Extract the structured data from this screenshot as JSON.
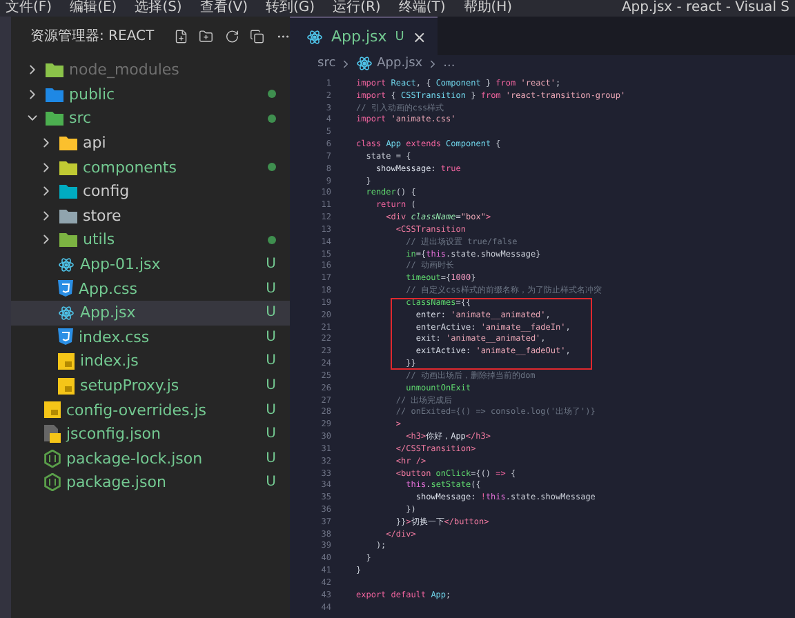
{
  "menu_bar": {
    "items": [
      "文件(F)",
      "编辑(E)",
      "选择(S)",
      "查看(V)",
      "转到(G)",
      "运行(R)",
      "终端(T)",
      "帮助(H)"
    ],
    "window_title": "App.jsx - react - Visual S"
  },
  "explorer": {
    "title": "资源管理器: REACT",
    "items": [
      {
        "name": "node_modules",
        "kind": "folder",
        "color": "#8bc34a",
        "expanded": false,
        "ignored": true,
        "modified": false,
        "selected": false
      },
      {
        "name": "public",
        "kind": "folder",
        "color": "#1e88e5",
        "expanded": false,
        "ignored": false,
        "modified": true,
        "selected": false
      },
      {
        "name": "src",
        "kind": "folder",
        "color": "#4caf50",
        "expanded": true,
        "ignored": false,
        "modified": true,
        "selected": false,
        "children": [
          {
            "name": "api",
            "kind": "folder",
            "color": "#fbc02d",
            "expanded": false,
            "ignored": false,
            "modified": false,
            "selected": false
          },
          {
            "name": "components",
            "kind": "folder",
            "color": "#c0ca33",
            "expanded": false,
            "ignored": false,
            "modified": true,
            "selected": false
          },
          {
            "name": "config",
            "kind": "folder",
            "color": "#00acc1",
            "expanded": false,
            "ignored": false,
            "modified": false,
            "selected": false
          },
          {
            "name": "store",
            "kind": "folder",
            "color": "#90a4ae",
            "expanded": false,
            "ignored": false,
            "modified": false,
            "selected": false
          },
          {
            "name": "utils",
            "kind": "folder",
            "color": "#7cb342",
            "expanded": false,
            "ignored": false,
            "modified": true,
            "selected": false
          },
          {
            "name": "App-01.jsx",
            "kind": "react",
            "badge": "U",
            "ignored": false,
            "modified": false,
            "selected": false
          },
          {
            "name": "App.css",
            "kind": "css",
            "badge": "U",
            "ignored": false,
            "modified": false,
            "selected": false
          },
          {
            "name": "App.jsx",
            "kind": "react",
            "badge": "U",
            "ignored": false,
            "modified": false,
            "selected": true
          },
          {
            "name": "index.css",
            "kind": "css",
            "badge": "U",
            "ignored": false,
            "modified": false,
            "selected": false
          },
          {
            "name": "index.js",
            "kind": "js",
            "badge": "U",
            "ignored": false,
            "modified": false,
            "selected": false
          },
          {
            "name": "setupProxy.js",
            "kind": "js",
            "badge": "U",
            "ignored": false,
            "modified": false,
            "selected": false
          }
        ]
      },
      {
        "name": "config-overrides.js",
        "kind": "js",
        "badge": "U",
        "ignored": false,
        "modified": false,
        "selected": false
      },
      {
        "name": "jsconfig.json",
        "kind": "jsconfig",
        "badge": "U",
        "ignored": false,
        "modified": false,
        "selected": false
      },
      {
        "name": "package-lock.json",
        "kind": "node",
        "badge": "U",
        "ignored": false,
        "modified": false,
        "selected": false
      },
      {
        "name": "package.json",
        "kind": "node",
        "badge": "U",
        "ignored": false,
        "modified": false,
        "selected": false
      }
    ]
  },
  "tabs": [
    {
      "label": "App.jsx",
      "kind": "react",
      "badge": "U",
      "close": "×",
      "selected": true
    }
  ],
  "breadcrumb": [
    "src",
    "App.jsx",
    "..."
  ],
  "code": [
    {
      "n": "1",
      "boxed": false,
      "tokens": [
        {
          "kind": "kw",
          "t": "import "
        },
        {
          "kind": "cls",
          "t": "React"
        },
        {
          "kind": "p",
          "t": ", { "
        },
        {
          "kind": "cls",
          "t": "Component"
        },
        {
          "kind": "p",
          "t": " } "
        },
        {
          "kind": "kw",
          "t": "from "
        },
        {
          "kind": "str",
          "t": "'react'"
        },
        {
          "kind": "p",
          "t": ";"
        }
      ]
    },
    {
      "n": "2",
      "boxed": false,
      "tokens": [
        {
          "kind": "kw",
          "t": "import "
        },
        {
          "kind": "p",
          "t": "{ "
        },
        {
          "kind": "cls",
          "t": "CSSTransition"
        },
        {
          "kind": "p",
          "t": " } "
        },
        {
          "kind": "kw",
          "t": "from "
        },
        {
          "kind": "str",
          "t": "'react-transition-group'"
        }
      ]
    },
    {
      "n": "3",
      "boxed": false,
      "tokens": [
        {
          "kind": "cm",
          "t": "// 引入动画的css样式"
        }
      ]
    },
    {
      "n": "4",
      "boxed": false,
      "tokens": [
        {
          "kind": "kw",
          "t": "import "
        },
        {
          "kind": "str",
          "t": "'animate.css'"
        }
      ]
    },
    {
      "n": "5",
      "boxed": false
    },
    {
      "n": "6",
      "boxed": false,
      "tokens": [
        {
          "kind": "kw",
          "t": "class "
        },
        {
          "kind": "cls",
          "t": "App "
        },
        {
          "kind": "kw",
          "t": "extends "
        },
        {
          "kind": "cls",
          "t": "Component"
        },
        {
          "kind": "p",
          "t": " {"
        }
      ]
    },
    {
      "n": "7",
      "boxed": false,
      "tokens": [
        {
          "kind": "p",
          "t": "  state = {"
        }
      ]
    },
    {
      "n": "8",
      "boxed": false,
      "tokens": [
        {
          "kind": "prop",
          "t": "    showMessage: "
        },
        {
          "kind": "kw",
          "t": "true"
        }
      ]
    },
    {
      "n": "9",
      "boxed": false,
      "tokens": [
        {
          "kind": "p",
          "t": "  }"
        }
      ]
    },
    {
      "n": "10",
      "boxed": false,
      "tokens": [
        {
          "kind": "fn",
          "t": "  render"
        },
        {
          "kind": "p",
          "t": "() {"
        }
      ]
    },
    {
      "n": "11",
      "boxed": false,
      "tokens": [
        {
          "kind": "kw",
          "t": "    return "
        },
        {
          "kind": "p",
          "t": "("
        }
      ]
    },
    {
      "n": "12",
      "boxed": false,
      "tokens": [
        {
          "kind": "tag",
          "t": "      <div "
        },
        {
          "kind": "attr",
          "t": "className"
        },
        {
          "kind": "p",
          "t": "="
        },
        {
          "kind": "str",
          "t": "\"box\""
        },
        {
          "kind": "tag",
          "t": ">"
        }
      ]
    },
    {
      "n": "13",
      "boxed": false,
      "tokens": [
        {
          "kind": "tag",
          "t": "        <CSSTransition"
        }
      ]
    },
    {
      "n": "14",
      "boxed": false,
      "tokens": [
        {
          "kind": "cm",
          "t": "          // 进出场设置 true/false"
        }
      ]
    },
    {
      "n": "15",
      "boxed": false,
      "tokens": [
        {
          "kind": "jsx",
          "t": "          in"
        },
        {
          "kind": "p",
          "t": "={"
        },
        {
          "kind": "this",
          "t": "this"
        },
        {
          "kind": "p",
          "t": ".state.showMessage}"
        }
      ]
    },
    {
      "n": "16",
      "boxed": false,
      "tokens": [
        {
          "kind": "cm",
          "t": "          // 动画时长"
        }
      ]
    },
    {
      "n": "17",
      "boxed": false,
      "tokens": [
        {
          "kind": "jsx",
          "t": "          timeout"
        },
        {
          "kind": "p",
          "t": "={"
        },
        {
          "kind": "num",
          "t": "1000"
        },
        {
          "kind": "p",
          "t": "}"
        }
      ]
    },
    {
      "n": "18",
      "boxed": false,
      "tokens": [
        {
          "kind": "cm",
          "t": "          // 自定义css样式的前缀名称，为了防止样式名冲突"
        }
      ]
    },
    {
      "n": "19",
      "boxed": true,
      "tokens": [
        {
          "kind": "jsx",
          "t": "          classNames"
        },
        {
          "kind": "p",
          "t": "={{"
        }
      ]
    },
    {
      "n": "20",
      "boxed": true,
      "tokens": [
        {
          "kind": "prop",
          "t": "            enter: "
        },
        {
          "kind": "str",
          "t": "'animate__animated'"
        },
        {
          "kind": "p",
          "t": ","
        }
      ]
    },
    {
      "n": "21",
      "boxed": true,
      "tokens": [
        {
          "kind": "prop",
          "t": "            enterActive: "
        },
        {
          "kind": "str",
          "t": "'animate__fadeIn'"
        },
        {
          "kind": "p",
          "t": ","
        }
      ]
    },
    {
      "n": "22",
      "boxed": true,
      "tokens": [
        {
          "kind": "prop",
          "t": "            exit: "
        },
        {
          "kind": "str",
          "t": "'animate__animated'"
        },
        {
          "kind": "p",
          "t": ","
        }
      ]
    },
    {
      "n": "23",
      "boxed": true,
      "tokens": [
        {
          "kind": "prop",
          "t": "            exitActive: "
        },
        {
          "kind": "str",
          "t": "'animate__fadeOut'"
        },
        {
          "kind": "p",
          "t": ","
        }
      ]
    },
    {
      "n": "24",
      "boxed": true,
      "tokens": [
        {
          "kind": "p",
          "t": "          }}"
        }
      ]
    },
    {
      "n": "25",
      "boxed": false,
      "tokens": [
        {
          "kind": "cm",
          "t": "          // 动画出场后，删除掉当前的dom"
        }
      ]
    },
    {
      "n": "26",
      "boxed": false,
      "tokens": [
        {
          "kind": "jsx",
          "t": "          unmountOnExit"
        }
      ]
    },
    {
      "n": "27",
      "boxed": false,
      "tokens": [
        {
          "kind": "cm",
          "t": "        // 出场完成后"
        }
      ]
    },
    {
      "n": "28",
      "boxed": false,
      "tokens": [
        {
          "kind": "cm",
          "t": "        // onExited={() => console.log('出场了')}"
        }
      ]
    },
    {
      "n": "29",
      "boxed": false,
      "tokens": [
        {
          "kind": "tag",
          "t": "        >"
        }
      ]
    },
    {
      "n": "30",
      "boxed": false,
      "tokens": [
        {
          "kind": "tag",
          "t": "          <h3>"
        },
        {
          "kind": "prop",
          "t": "你好，App"
        },
        {
          "kind": "tag",
          "t": "</h3>"
        }
      ]
    },
    {
      "n": "31",
      "boxed": false,
      "tokens": [
        {
          "kind": "tag",
          "t": "        </CSSTransition>"
        }
      ]
    },
    {
      "n": "32",
      "boxed": false,
      "tokens": [
        {
          "kind": "tag",
          "t": "        <hr />"
        }
      ]
    },
    {
      "n": "33",
      "boxed": false,
      "tokens": [
        {
          "kind": "tag",
          "t": "        <button "
        },
        {
          "kind": "jsx",
          "t": "onClick"
        },
        {
          "kind": "p",
          "t": "={() "
        },
        {
          "kind": "kw",
          "t": "=>"
        },
        {
          "kind": "p",
          "t": " {"
        }
      ]
    },
    {
      "n": "34",
      "boxed": false,
      "tokens": [
        {
          "kind": "this",
          "t": "          this"
        },
        {
          "kind": "p",
          "t": "."
        },
        {
          "kind": "fn",
          "t": "setState"
        },
        {
          "kind": "p",
          "t": "({"
        }
      ]
    },
    {
      "n": "35",
      "boxed": false,
      "tokens": [
        {
          "kind": "prop",
          "t": "            showMessage: "
        },
        {
          "kind": "kw",
          "t": "!"
        },
        {
          "kind": "this",
          "t": "this"
        },
        {
          "kind": "p",
          "t": ".state.showMessage"
        }
      ]
    },
    {
      "n": "36",
      "boxed": false,
      "tokens": [
        {
          "kind": "p",
          "t": "          })"
        }
      ]
    },
    {
      "n": "37",
      "boxed": false,
      "tokens": [
        {
          "kind": "p",
          "t": "        }}"
        },
        {
          "kind": "tag",
          "t": ">"
        },
        {
          "kind": "prop",
          "t": "切换一下"
        },
        {
          "kind": "tag",
          "t": "</button>"
        }
      ]
    },
    {
      "n": "38",
      "boxed": false,
      "tokens": [
        {
          "kind": "tag",
          "t": "      </div>"
        }
      ]
    },
    {
      "n": "39",
      "boxed": false,
      "tokens": [
        {
          "kind": "p",
          "t": "    );"
        }
      ]
    },
    {
      "n": "40",
      "boxed": false,
      "tokens": [
        {
          "kind": "p",
          "t": "  }"
        }
      ]
    },
    {
      "n": "41",
      "boxed": false,
      "tokens": [
        {
          "kind": "p",
          "t": "}"
        }
      ]
    },
    {
      "n": "42",
      "boxed": false
    },
    {
      "n": "43",
      "boxed": false,
      "tokens": [
        {
          "kind": "kw",
          "t": "export default "
        },
        {
          "kind": "cls",
          "t": "App"
        },
        {
          "kind": "p",
          "t": ";"
        }
      ]
    },
    {
      "n": "44",
      "boxed": false
    }
  ]
}
